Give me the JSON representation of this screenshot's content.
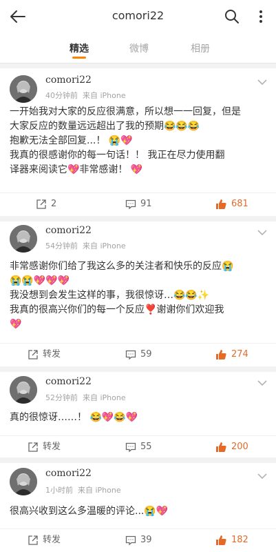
{
  "header": {
    "title": "comori22"
  },
  "tabs": [
    {
      "label": "精选"
    },
    {
      "label": "微博"
    },
    {
      "label": "相册"
    }
  ],
  "posts": [
    {
      "username": "comori22",
      "time": "40分钟前",
      "source": "来自 iPhone",
      "lines": [
        "一开始我对大家的反应很满意，所以想一一回复，但是",
        "大家反应的数量远远超出了我的预期😂😂😂",
        "抱歉无法全部回复...！ 😭💖",
        "我真的很感谢你的每一句话！！ 我正在尽力使用翻",
        "译器来阅读它💖非常感谢！ 💖"
      ],
      "repost": "2",
      "comments": "91",
      "likes": "681"
    },
    {
      "username": "comori22",
      "time": "54分钟前",
      "source": "来自 iPhone",
      "lines": [
        "非常感谢你们给了我这么多的关注者和快乐的反应😭",
        "😭😭💖💖💖",
        "我没想到会发生这样的事，我很惊讶…😂😂✨",
        "我真的很高兴你们的每一个反应❣️谢谢你们欢迎我",
        "💖"
      ],
      "repost": "转发",
      "comments": "59",
      "likes": "274"
    },
    {
      "username": "comori22",
      "time": "52分钟前",
      "source": "来自 iPhone",
      "lines": [
        "真的很惊讶……！ 😂💖😂💖"
      ],
      "repost": "转发",
      "comments": "55",
      "likes": "200"
    },
    {
      "username": "comori22",
      "time": "1小时前",
      "source": "来自 iPhone",
      "lines": [
        "很高兴收到这么多温暖的评论...😭💖"
      ],
      "repost": "转发",
      "comments": "39",
      "likes": "182"
    }
  ],
  "icons": {
    "back": "arrow-left-icon",
    "search": "search-icon",
    "more": "more-vertical-icon",
    "chevron": "chevron-down-icon",
    "repost": "share-icon",
    "comment": "comment-icon",
    "like": "thumbs-up-icon"
  },
  "colors": {
    "accent": "#ff8200",
    "like": "#e56a28",
    "meta": "#a3a3a3",
    "background": "#f2f2f2"
  }
}
